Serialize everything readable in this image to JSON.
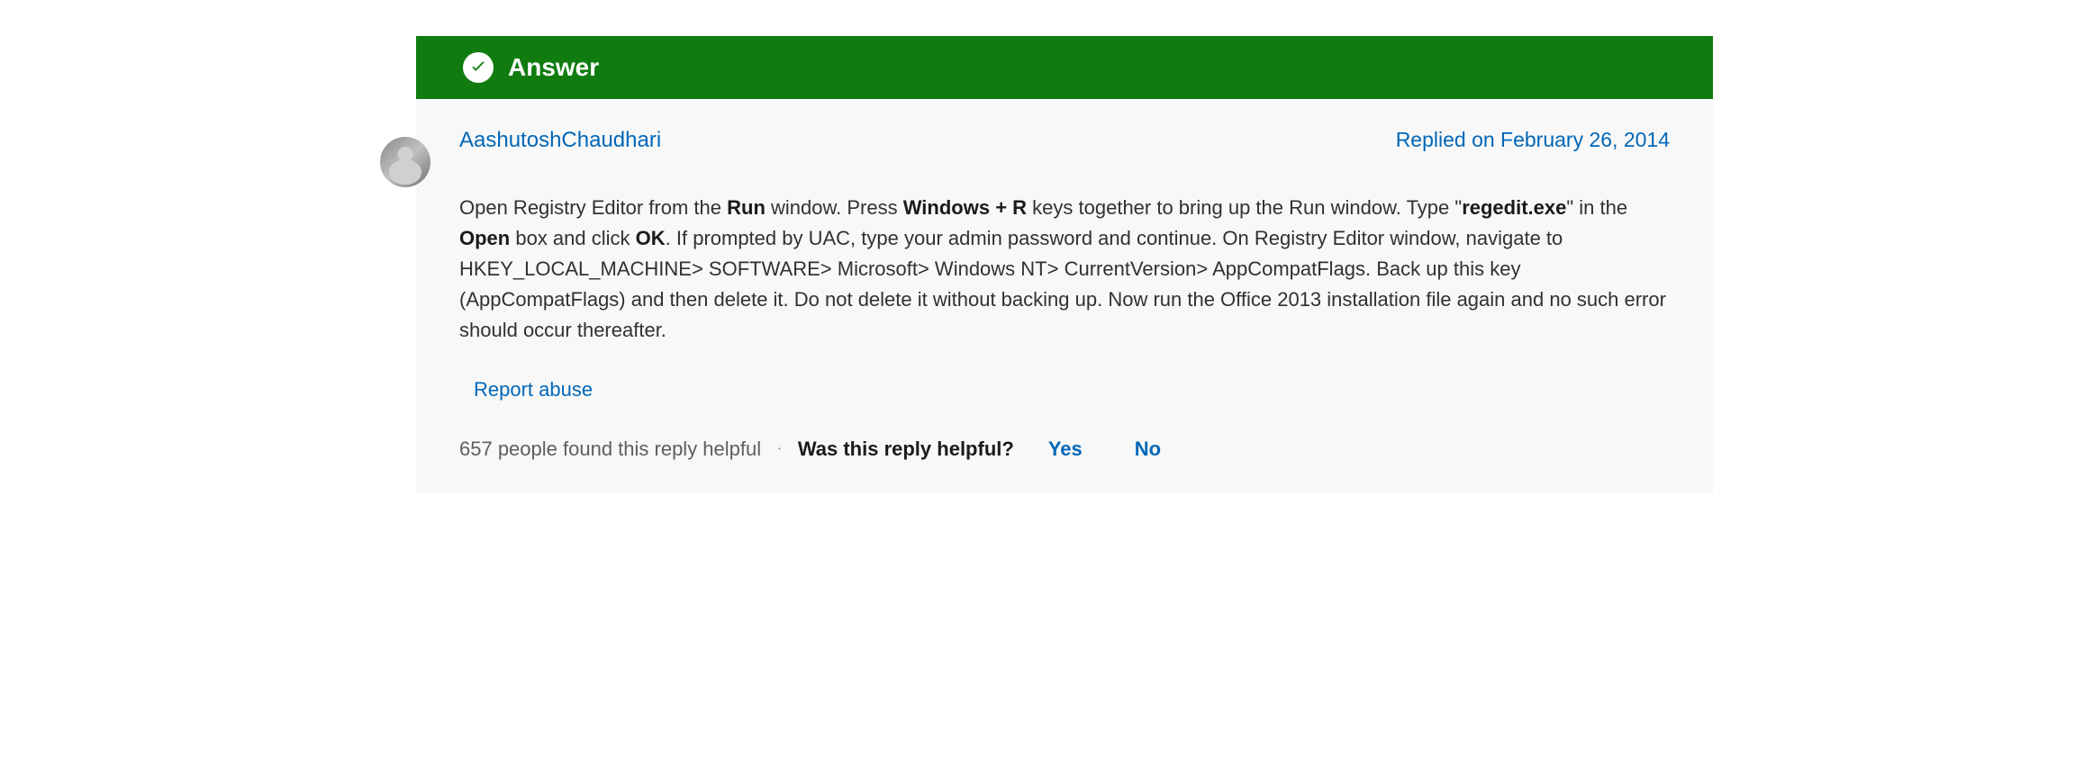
{
  "header": {
    "label": "Answer"
  },
  "post": {
    "author": "AashutoshChaudhari",
    "reply_date": "Replied on February 26, 2014",
    "content": {
      "seg1": "Open Registry Editor from the ",
      "b1": "Run",
      "seg2": " window. Press ",
      "b2": "Windows + R",
      "seg3": " keys together to bring up the Run window. Type \"",
      "b3": "regedit.exe",
      "seg4": "\" in the ",
      "b4": "Open",
      "seg5": " box and click ",
      "b5": "OK",
      "seg6": ". If prompted by UAC, type your admin password and continue. On Registry Editor window, navigate to HKEY_LOCAL_MACHINE> SOFTWARE> Microsoft> Windows NT> CurrentVersion> AppCompatFlags. Back up this key (AppCompatFlags) and then delete it. Do not delete it without backing up. Now run the Office 2013 installation file again and no such error should occur thereafter."
    },
    "report_abuse": "Report abuse",
    "helpful": {
      "count_text": "657 people found this reply helpful",
      "question": "Was this reply helpful?",
      "yes": "Yes",
      "no": "No"
    }
  }
}
